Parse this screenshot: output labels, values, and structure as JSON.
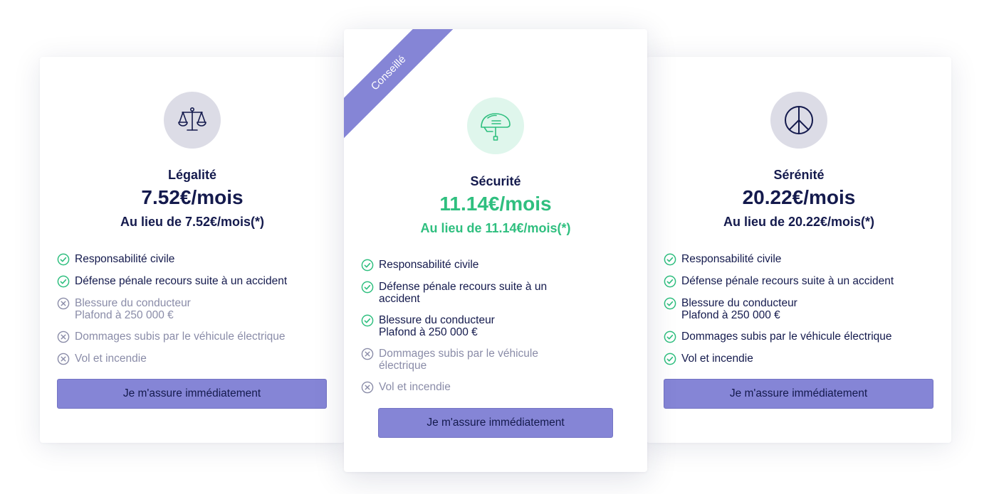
{
  "colors": {
    "accent": "#8585d6",
    "navy": "#141a4d",
    "green": "#2fbf7f",
    "muted": "#8a8ca8",
    "icon_bg_grey": "#dcdce6",
    "icon_bg_mint": "#dff6ec"
  },
  "plans": [
    {
      "icon": "scales-icon",
      "name": "Légalité",
      "price": "7.52€/mois",
      "original_price": "Au lieu de 7.52€/mois(*)",
      "features": [
        {
          "label": "Responsabilité civile",
          "included": true
        },
        {
          "label": "Défense pénale recours suite à un accident",
          "included": true
        },
        {
          "label": "Blessure du conducteur",
          "sub": "Plafond à 250 000 €",
          "included": false
        },
        {
          "label": "Dommages subis par le véhicule électrique",
          "included": false
        },
        {
          "label": "Vol et incendie",
          "included": false
        }
      ],
      "cta": "Je m'assure immédiatement"
    },
    {
      "ribbon": "Conseillé",
      "icon": "helmet-icon",
      "name": "Sécurité",
      "price": "11.14€/mois",
      "original_price": "Au lieu de 11.14€/mois(*)",
      "features": [
        {
          "label": "Responsabilité civile",
          "included": true
        },
        {
          "label": "Défense pénale recours suite à un accident",
          "included": true
        },
        {
          "label": "Blessure du conducteur",
          "sub": "Plafond à 250 000 €",
          "included": true
        },
        {
          "label": "Dommages subis par le véhicule électrique",
          "included": false
        },
        {
          "label": "Vol et incendie",
          "included": false
        }
      ],
      "cta": "Je m'assure immédiatement"
    },
    {
      "icon": "peace-icon",
      "name": "Sérénité",
      "price": "20.22€/mois",
      "original_price": "Au lieu de 20.22€/mois(*)",
      "features": [
        {
          "label": "Responsabilité civile",
          "included": true
        },
        {
          "label": "Défense pénale recours suite à un accident",
          "included": true
        },
        {
          "label": "Blessure du conducteur",
          "sub": "Plafond à 250 000 €",
          "included": true
        },
        {
          "label": "Dommages subis par le véhicule électrique",
          "included": true
        },
        {
          "label": "Vol et incendie",
          "included": true
        }
      ],
      "cta": "Je m'assure immédiatement"
    }
  ]
}
